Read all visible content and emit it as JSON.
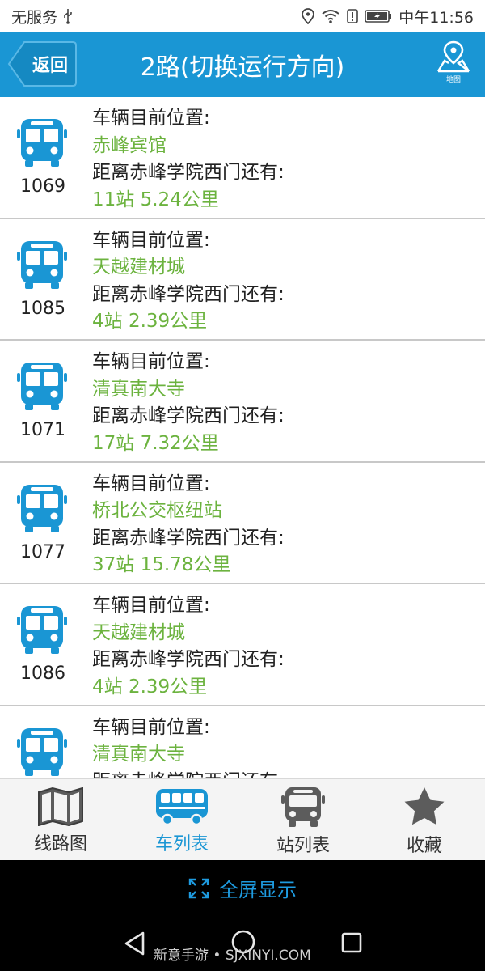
{
  "status_bar": {
    "carrier": "无服务",
    "time": "中午11:56",
    "icons": [
      "usb-icon",
      "location-icon",
      "wifi-icon",
      "alert-icon",
      "battery-icon"
    ]
  },
  "header": {
    "back_label": "返回",
    "title": "2路(切换运行方向)",
    "map_label": "地图",
    "accent_color": "#1a96d4"
  },
  "list": {
    "position_label": "车辆目前位置:",
    "distance_label": "距离赤峰学院西门还有:",
    "highlight_color": "#6cb33f",
    "rows": [
      {
        "bus": "1069",
        "location": "赤峰宾馆",
        "distance": "11站  5.24公里"
      },
      {
        "bus": "1085",
        "location": "天越建材城",
        "distance": "4站  2.39公里"
      },
      {
        "bus": "1071",
        "location": "清真南大寺",
        "distance": "17站  7.32公里"
      },
      {
        "bus": "1077",
        "location": "桥北公交枢纽站",
        "distance": "37站  15.78公里"
      },
      {
        "bus": "1086",
        "location": "天越建材城",
        "distance": "4站  2.39公里"
      },
      {
        "bus": "",
        "location": "清真南大寺",
        "distance": ""
      }
    ]
  },
  "tabs": [
    {
      "label": "线路图",
      "icon": "map-icon",
      "active": false
    },
    {
      "label": "车列表",
      "icon": "bus-icon",
      "active": true
    },
    {
      "label": "站列表",
      "icon": "bus-front-icon",
      "active": false
    },
    {
      "label": "收藏",
      "icon": "star-icon",
      "active": false
    }
  ],
  "fullscreen": {
    "label": "全屏显示"
  },
  "navbar": {
    "watermark": "新意手游 • SJXINYI.COM"
  }
}
